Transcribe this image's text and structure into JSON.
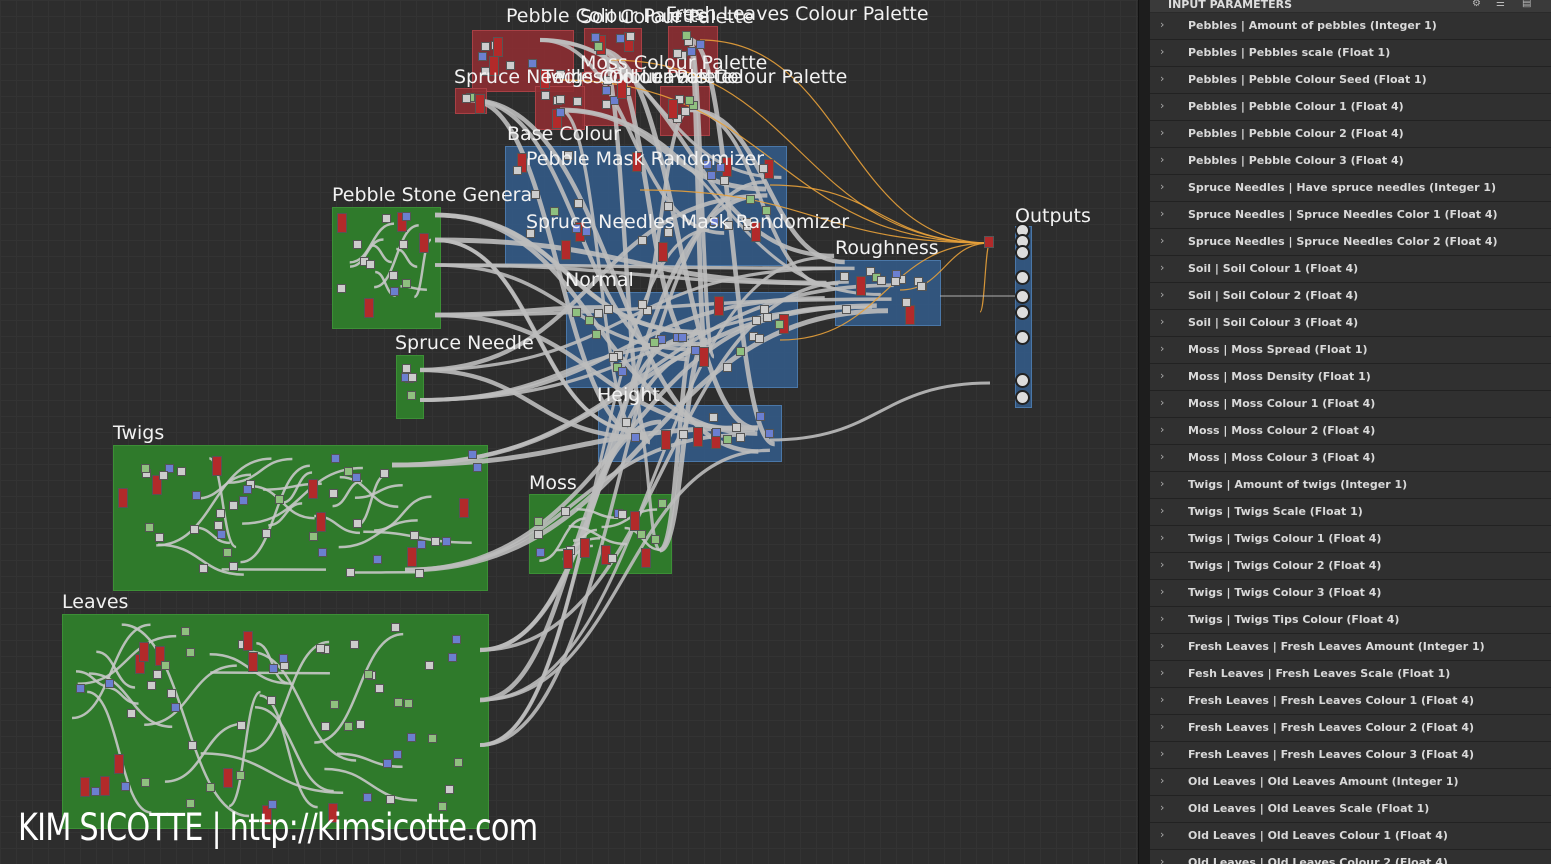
{
  "graph": {
    "frames": [
      {
        "id": "pebble-colour-palette",
        "title": "Pebble Colour Palette"
      },
      {
        "id": "soil-colour-palette",
        "title": "Soil Colour Palette"
      },
      {
        "id": "fresh-leaves-colour-palette",
        "title": "Fresh Leaves Colour Palette"
      },
      {
        "id": "moss-colour-palette",
        "title": "Moss Colour Palette"
      },
      {
        "id": "spruce-needles-colour-palette",
        "title": "Spruce Needles Colour Palette"
      },
      {
        "id": "twigs-colour-palette",
        "title": "Twigs Colour Palette"
      },
      {
        "id": "old-leaves-colour-palette",
        "title": "Old Leaves Colour Palette"
      },
      {
        "id": "base-colour",
        "title": "Base Colour"
      },
      {
        "id": "pebble-mask-randomizer",
        "title": "Pebble Mask Randomizer"
      },
      {
        "id": "pebble-stone-generator",
        "title": "Pebble Stone Genera"
      },
      {
        "id": "spruce-needles-mask-randomizer",
        "title": "Spruce Needles Mask Randomizer"
      },
      {
        "id": "roughness",
        "title": "Roughness"
      },
      {
        "id": "outputs",
        "title": "Outputs"
      },
      {
        "id": "normal",
        "title": "Normal"
      },
      {
        "id": "spruce-needles",
        "title": "Spruce Needle"
      },
      {
        "id": "height",
        "title": "Height"
      },
      {
        "id": "twigs",
        "title": "Twigs"
      },
      {
        "id": "moss",
        "title": "Moss"
      },
      {
        "id": "leaves",
        "title": "Leaves"
      }
    ],
    "watermark": "KIM SICOTTE | http://kimsicotte.com"
  },
  "panel": {
    "title": "INPUT PARAMETERS",
    "params": [
      "Pebbles | Amount of pebbles (Integer 1)",
      "Pebbles | Pebbles scale (Float 1)",
      "Pebbles | Pebble Colour Seed (Float 1)",
      "Pebbles | Pebble Colour 1 (Float 4)",
      "Pebbles | Pebble Colour 2 (Float 4)",
      "Pebbles | Pebble Colour 3 (Float 4)",
      "Spruce Needles | Have spruce needles (Integer 1)",
      "Spruce Needles | Spruce Needles Color 1 (Float 4)",
      "Spruce Needles | Spruce Needles Color 2 (Float 4)",
      "Soil | Soil Colour 1 (Float 4)",
      "Soil | Soil Colour 2 (Float 4)",
      "Soil | Soil Colour 3 (Float 4)",
      "Moss | Moss Spread (Float 1)",
      "Moss | Moss Density (Float 1)",
      "Moss | Moss Colour 1 (Float 4)",
      "Moss | Moss Colour 2 (Float 4)",
      "Moss | Moss Colour 3 (Float 4)",
      "Twigs | Amount of twigs (Integer 1)",
      "Twigs | Twigs Scale (Float 1)",
      "Twigs | Twigs Colour 1 (Float 4)",
      "Twigs | Twigs Colour 2 (Float 4)",
      "Twigs | Twigs Colour 3 (Float 4)",
      "Twigs | Twigs Tips Colour (Float 4)",
      "Fresh Leaves | Fresh Leaves Amount (Integer 1)",
      "Fesh Leaves | Fresh Leaves Scale (Float 1)",
      "Fresh Leaves | Fresh Leaves Colour 1 (Float 4)",
      "Fresh Leaves | Fresh Leaves Colour 2 (Float 4)",
      "Fresh Leaves | Fresh Leaves Colour 3 (Float 4)",
      "Old Leaves | Old Leaves Amount (Integer 1)",
      "Old Leaves | Old Leaves Scale (Float 1)",
      "Old Leaves | Old Leaves Colour 1 (Float 4)",
      "Old Leaves | Old Leaves Colour 2 (Float 4)"
    ]
  },
  "colors": {
    "frame_green": "#2f7a2b",
    "frame_blue": "#345d8c",
    "frame_red": "#8c2d32",
    "wire": "#bdbdbd",
    "wire_orange": "#e8a13a"
  }
}
